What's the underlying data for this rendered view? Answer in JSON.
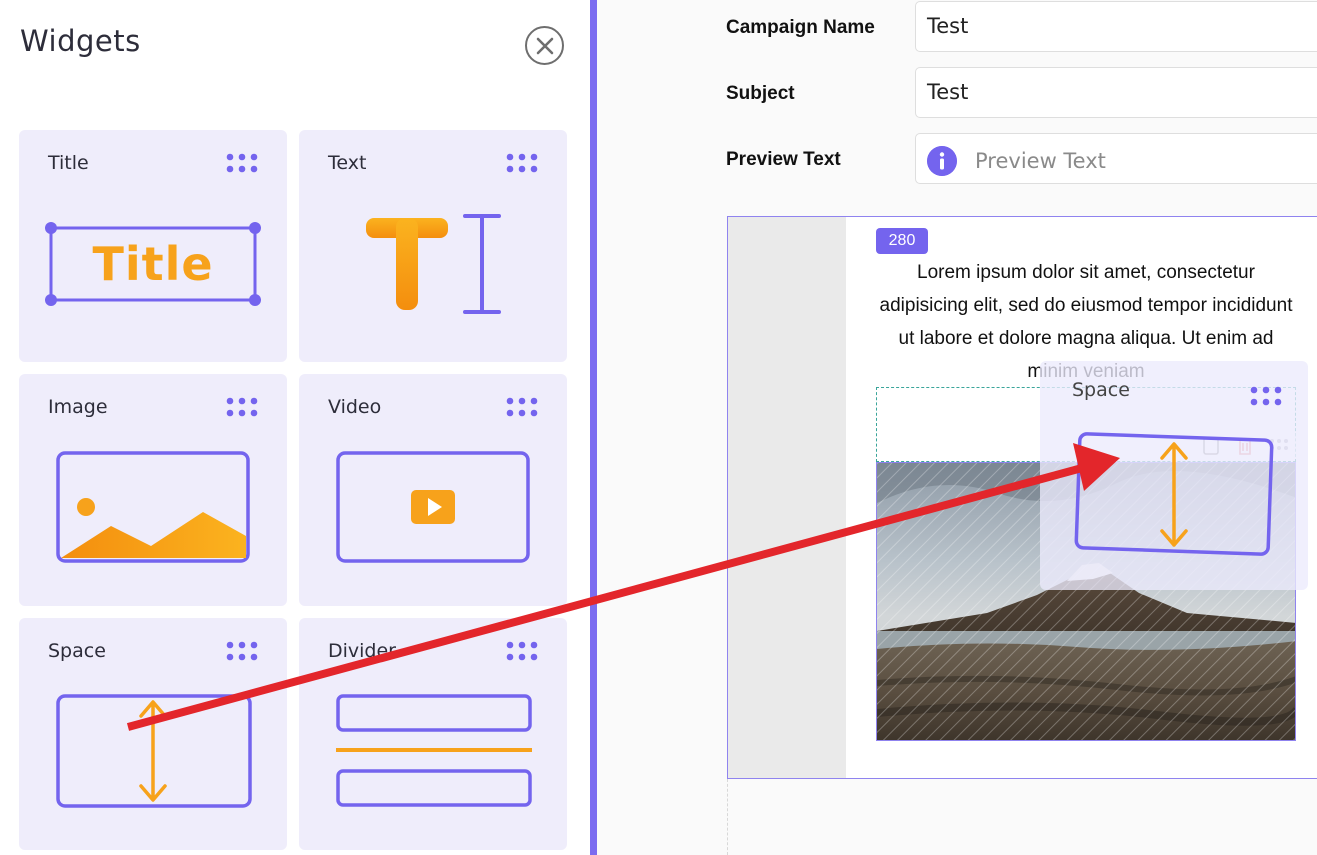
{
  "sidebar": {
    "title": "Widgets",
    "widgets": [
      {
        "label": "Title",
        "art_text": "Title"
      },
      {
        "label": "Text"
      },
      {
        "label": "Image"
      },
      {
        "label": "Video"
      },
      {
        "label": "Space"
      },
      {
        "label": "Divider"
      }
    ]
  },
  "form": {
    "campaign_name_label": "Campaign Name",
    "campaign_name_value": "Test",
    "subject_label": "Subject",
    "subject_value": "Test",
    "preview_text_label": "Preview Text",
    "preview_text_placeholder": "Preview Text"
  },
  "canvas": {
    "badge": "280",
    "paragraph": "Lorem ipsum dolor sit amet, consectetur adipisicing elit, sed do eiusmod tempor incididunt ut labore et dolore magna aliqua. Ut enim ad minim veniam"
  },
  "drag_ghost": {
    "label": "Space"
  },
  "colors": {
    "accent": "#7464ee",
    "orange": "#f7a21b",
    "card_bg": "#efedfb",
    "annotation_arrow": "#e3262b"
  },
  "icons": [
    "close-icon",
    "drag-grip-icon",
    "info-icon",
    "title-icon",
    "text-cursor-icon",
    "image-icon",
    "video-icon",
    "space-icon",
    "divider-icon",
    "copy-icon",
    "delete-icon"
  ]
}
